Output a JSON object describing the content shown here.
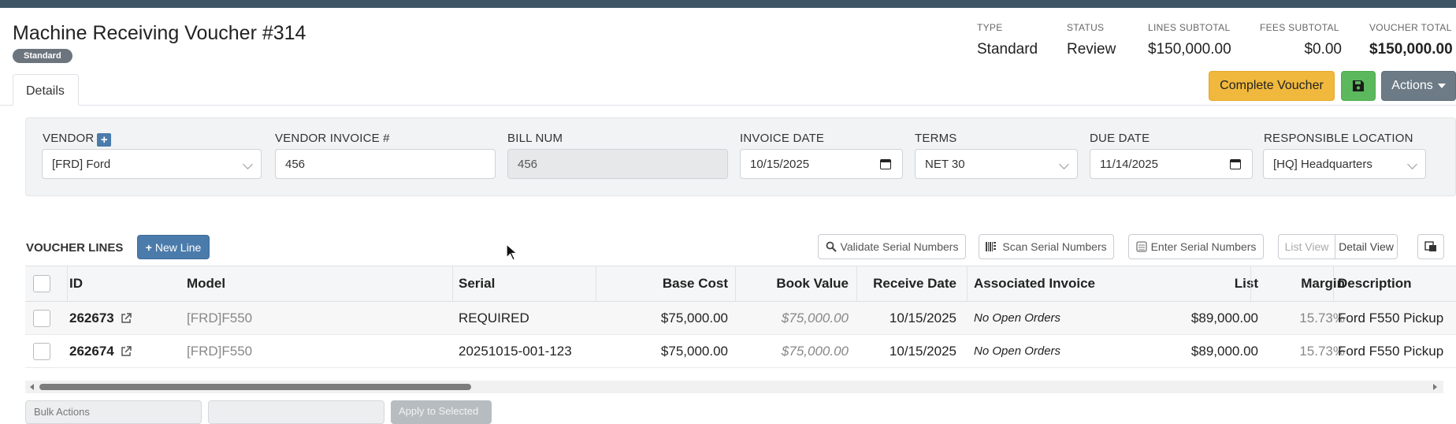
{
  "header": {
    "title": "Machine Receiving Voucher #314",
    "badge": "Standard"
  },
  "summary": [
    {
      "label": "TYPE",
      "value": "Standard"
    },
    {
      "label": "STATUS",
      "value": "Review"
    },
    {
      "label": "LINES SUBTOTAL",
      "value": "$150,000.00"
    },
    {
      "label": "FEES SUBTOTAL",
      "value": "$0.00"
    },
    {
      "label": "VOUCHER TOTAL",
      "value": "$150,000.00"
    }
  ],
  "tabs": {
    "details": "Details"
  },
  "toolbar": {
    "complete": "Complete Voucher",
    "save_icon": "floppy-disk-icon",
    "actions": "Actions"
  },
  "form": {
    "vendor": {
      "label": "VENDOR",
      "value": "[FRD] Ford"
    },
    "vendor_invoice": {
      "label": "VENDOR INVOICE #",
      "value": "456"
    },
    "bill_num": {
      "label": "BILL NUM",
      "value": "456"
    },
    "invoice_date": {
      "label": "INVOICE DATE",
      "value": "10/15/2025"
    },
    "terms": {
      "label": "TERMS",
      "value": "NET 30"
    },
    "due_date": {
      "label": "DUE DATE",
      "value": "11/14/2025"
    },
    "responsible_location": {
      "label": "RESPONSIBLE LOCATION",
      "value": "[HQ] Headquarters"
    }
  },
  "lines": {
    "title": "VOUCHER LINES",
    "new_line": "New Line",
    "validate": "Validate Serial Numbers",
    "scan": "Scan Serial Numbers",
    "enter": "Enter Serial Numbers",
    "list_view": "List View",
    "detail_view": "Detail View",
    "columns": [
      "ID",
      "Model",
      "Serial",
      "Base Cost",
      "Book Value",
      "Receive Date",
      "Associated Invoice",
      "List",
      "Margin",
      "Description"
    ],
    "rows": [
      {
        "id": "262673",
        "model": "[FRD]F550",
        "serial": "REQUIRED",
        "base_cost": "$75,000.00",
        "book_value": "$75,000.00",
        "receive_date": "10/15/2025",
        "invoice": "No Open Orders",
        "list": "$89,000.00",
        "margin": "15.73%",
        "description": "Ford F550 Pickup"
      },
      {
        "id": "262674",
        "model": "[FRD]F550",
        "serial": "20251015-001-123",
        "base_cost": "$75,000.00",
        "book_value": "$75,000.00",
        "receive_date": "10/15/2025",
        "invoice": "No Open Orders",
        "list": "$89,000.00",
        "margin": "15.73%",
        "description": "Ford F550 Pickup"
      }
    ]
  },
  "bottom": {
    "bulk_actions": "Bulk Actions",
    "apply_selected": "Apply to Selected"
  },
  "colors": {
    "accent": "#4b7bab",
    "complete": "#f0b83c",
    "save": "#5cb85c",
    "actions": "#6c7b86"
  }
}
